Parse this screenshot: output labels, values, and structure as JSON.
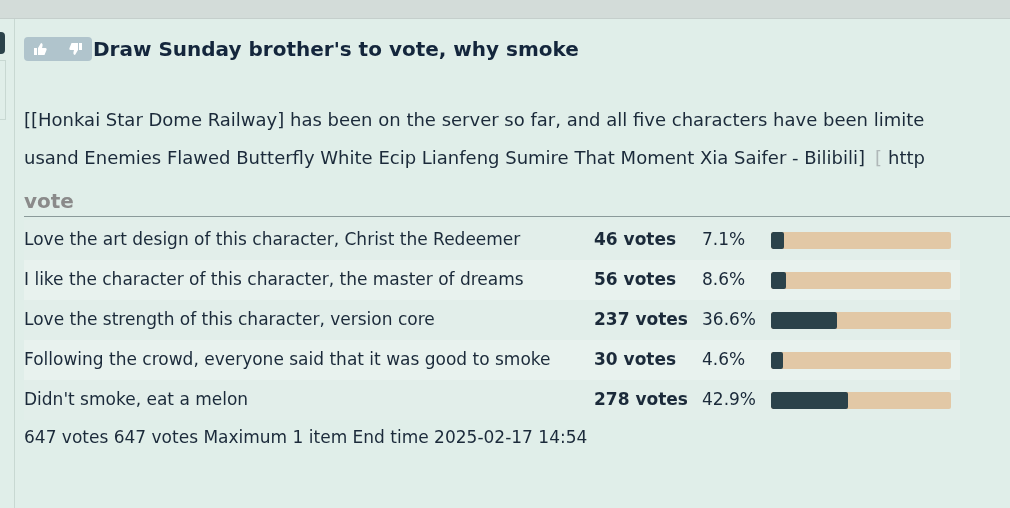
{
  "post": {
    "title": "Draw Sunday brother's to vote, why smoke",
    "body_lines": [
      "[[Honkai Star Dome Railway] has been on the server so far, and all five characters have been limite",
      "usand Enemies Flawed Butterfly White Ecip Lianfeng Sumire That Moment Xia Saifer - Bilibili]"
    ],
    "bracket": "[",
    "link": "http"
  },
  "poll": {
    "heading": "vote",
    "options": [
      {
        "label": "Love the art design of this character, Christ the Redeemer",
        "votes": "46 votes",
        "percent": "7.1%",
        "level": 0.071
      },
      {
        "label": "I like the character of this character, the master of dreams",
        "votes": "56 votes",
        "percent": "8.6%",
        "level": 0.086
      },
      {
        "label": "Love the strength of this character, version core",
        "votes": "237 votes",
        "percent": "36.6%",
        "level": 0.366
      },
      {
        "label": "Following the crowd, everyone said that it was good to smoke",
        "votes": "30 votes",
        "percent": "4.6%",
        "level": 0.046
      },
      {
        "label": "Didn't smoke, eat a melon",
        "votes": "278 votes",
        "percent": "42.9%",
        "level": 0.429
      }
    ],
    "summary": "647 votes 647 votes Maximum 1 item End time 2025-02-17 14:54"
  }
}
